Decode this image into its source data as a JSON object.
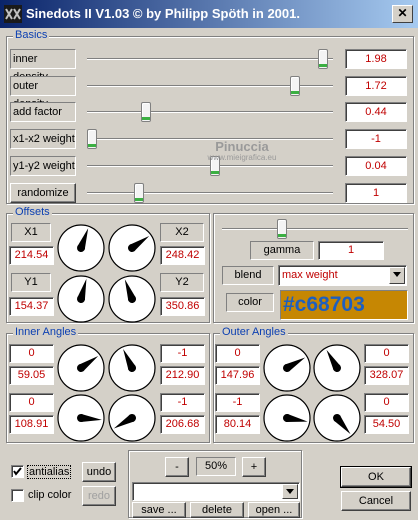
{
  "window": {
    "title": "Sinedots II V1.03 © by Philipp Spöth in 2001.",
    "close_label": "✕"
  },
  "watermark": {
    "line1": "Pinuccia",
    "line2": "www.mieigrafica.eu"
  },
  "basics": {
    "legend": "Basics",
    "rows": [
      {
        "label": "inner density",
        "value": "1.98",
        "level": 0.98
      },
      {
        "label": "outer density",
        "value": "1.72",
        "level": 0.86
      },
      {
        "label": "add factor",
        "value": "0.44",
        "level": 0.23
      },
      {
        "label": "x1-x2 weight",
        "value": "-1",
        "level": 0.0
      },
      {
        "label": "y1-y2 weight",
        "value": "0.04",
        "level": 0.52
      },
      {
        "label": "randomize",
        "value": "1",
        "level": 0.2
      }
    ]
  },
  "offsets": {
    "legend": "Offsets",
    "x1": {
      "label": "X1",
      "value": "214.54"
    },
    "y1": {
      "label": "Y1",
      "value": "154.37"
    },
    "x2": {
      "label": "X2",
      "value": "248.42"
    },
    "y2": {
      "label": "Y2",
      "value": "350.86"
    }
  },
  "gamma": {
    "label": "gamma",
    "value": "1",
    "level": 0.5
  },
  "blend": {
    "label": "blend",
    "selected": "max weight"
  },
  "color": {
    "label": "color",
    "hex": "#c68703",
    "text": "#c68703"
  },
  "inner_angles": {
    "legend": "Inner Angles",
    "rows": [
      {
        "left_top": "0",
        "left_bottom": "59.05",
        "right_top": "-1",
        "right_bottom": "212.90"
      },
      {
        "left_top": "0",
        "left_bottom": "108.91",
        "right_top": "-1",
        "right_bottom": "206.68"
      }
    ]
  },
  "outer_angles": {
    "legend": "Outer Angles",
    "rows": [
      {
        "left_top": "0",
        "left_bottom": "147.96",
        "right_top": "0",
        "right_bottom": "328.07"
      },
      {
        "left_top": "-1",
        "left_bottom": "80.14",
        "right_top": "0",
        "right_bottom": "54.50"
      }
    ]
  },
  "bottom": {
    "antialias_label": "antialias",
    "antialias_checked": true,
    "clip_color_label": "clip color",
    "clip_color_checked": false,
    "undo_label": "undo",
    "redo_label": "redo",
    "minus_label": "-",
    "plus_label": "+",
    "zoom": "50%",
    "preset_selected": "",
    "save_label": "save ...",
    "delete_label": "delete",
    "open_label": "open ...",
    "ok_label": "OK",
    "cancel_label": "Cancel"
  }
}
